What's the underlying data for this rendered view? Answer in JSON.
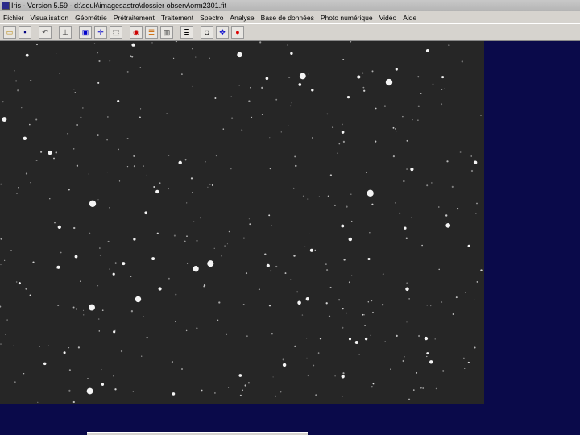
{
  "window": {
    "title": "Iris - Version 5.59 - d:\\souk\\imagesastro\\dossier observ\\orm2301.fit",
    "background_color": "#0a0a4a"
  },
  "menu": {
    "items": [
      "Fichier",
      "Visualisation",
      "Géométrie",
      "Prétraitement",
      "Traitement",
      "Spectro",
      "Analyse",
      "Base de données",
      "Photo numérique",
      "Vidéo",
      "Aide"
    ]
  },
  "toolbar": {
    "buttons": [
      {
        "name": "open-icon",
        "glyph": "▭",
        "color": "#b8860b"
      },
      {
        "name": "save-icon",
        "glyph": "▪",
        "color": "#000080"
      },
      {
        "name": "separator"
      },
      {
        "name": "undo-icon",
        "glyph": "↶",
        "color": "#555"
      },
      {
        "name": "separator"
      },
      {
        "name": "threshold-icon",
        "glyph": "⊥",
        "color": "#333"
      },
      {
        "name": "separator"
      },
      {
        "name": "zoom-box-icon",
        "glyph": "▣",
        "color": "#0000cc"
      },
      {
        "name": "crosshair-icon",
        "glyph": "✛",
        "color": "#0000cc"
      },
      {
        "name": "select-icon",
        "glyph": "⬚",
        "color": "#333"
      },
      {
        "name": "separator"
      },
      {
        "name": "view-icon",
        "glyph": "◉",
        "color": "#cc0000"
      },
      {
        "name": "list-icon",
        "glyph": "☰",
        "color": "#cc6600"
      },
      {
        "name": "bars-icon",
        "glyph": "▥",
        "color": "#333"
      },
      {
        "name": "separator"
      },
      {
        "name": "command-icon",
        "glyph": "≣",
        "color": "#000"
      },
      {
        "name": "separator"
      },
      {
        "name": "camera-icon",
        "glyph": "◘",
        "color": "#333"
      },
      {
        "name": "move-icon",
        "glyph": "✥",
        "color": "#0000cc"
      },
      {
        "name": "record-icon",
        "glyph": "●",
        "color": "#dd0000"
      }
    ]
  },
  "image": {
    "background_color": "#262626",
    "star_color": "#ffffff"
  }
}
